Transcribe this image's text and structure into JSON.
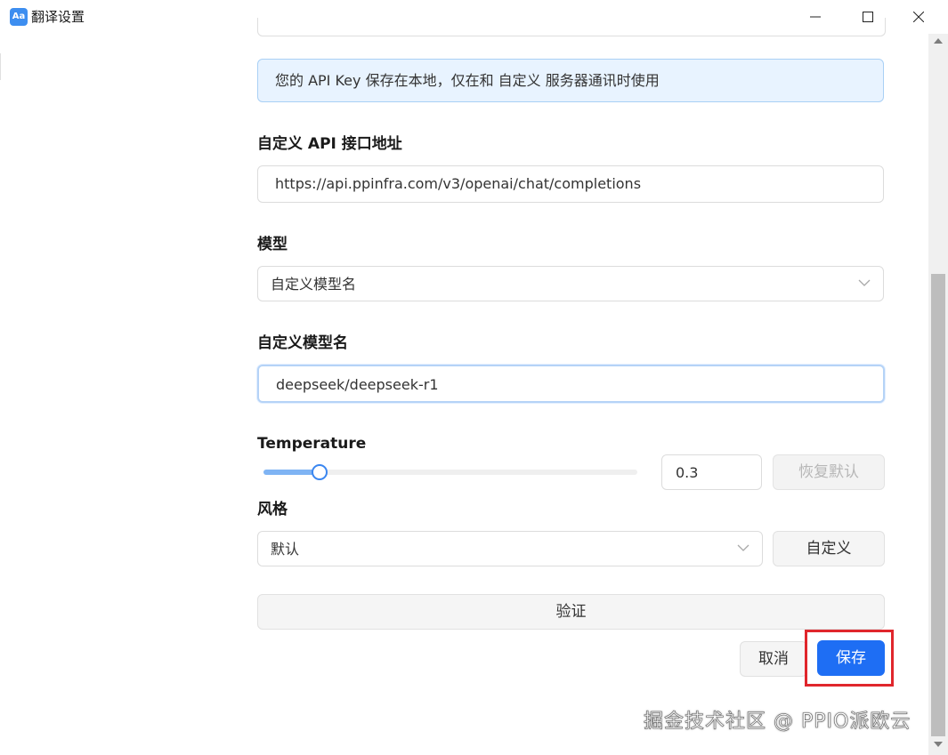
{
  "window": {
    "title": "翻译设置",
    "app_icon_text": "Aa"
  },
  "info": {
    "text": "您的 API Key 保存在本地，仅在和 自定义 服务器通讯时使用"
  },
  "api_endpoint": {
    "label": "自定义 API 接口地址",
    "value": "https://api.ppinfra.com/v3/openai/chat/completions"
  },
  "model": {
    "label": "模型",
    "selected": "自定义模型名"
  },
  "custom_model": {
    "label": "自定义模型名",
    "value": "deepseek/deepseek-r1"
  },
  "temperature": {
    "label": "Temperature",
    "value": "0.3",
    "slider_fraction": 0.15,
    "reset_label": "恢复默认"
  },
  "style": {
    "label": "风格",
    "selected": "默认",
    "custom_label": "自定义"
  },
  "verify_label": "验证",
  "actions": {
    "cancel_label": "取消",
    "save_label": "保存"
  },
  "watermark": "掘金技术社区 @ PPIO派欧云",
  "colors": {
    "primary": "#1e6ef4",
    "info_bg": "#e8f3ff",
    "highlight": "#e0262c"
  }
}
